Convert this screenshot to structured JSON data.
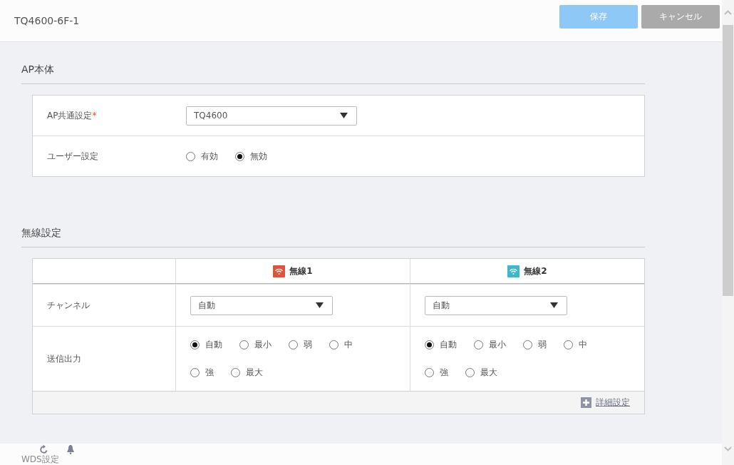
{
  "header": {
    "title": "TQ4600-6F-1",
    "buttons": [
      {
        "label": "保存",
        "kind": "primary"
      },
      {
        "label": "キャンセル",
        "kind": "secondary"
      }
    ]
  },
  "ap_section": {
    "title": "AP本体",
    "rows": [
      {
        "kind": "select",
        "label": "AP共通設定",
        "required_mark": "*",
        "value": "TQ4600"
      },
      {
        "kind": "radio",
        "label": "ユーザー設定",
        "options": [
          {
            "label": "有効",
            "selected": false
          },
          {
            "label": "無効",
            "selected": true
          }
        ]
      }
    ]
  },
  "wireless_section": {
    "title": "無線設定",
    "columns": [
      {
        "label": "無線1",
        "color": "#e0533a"
      },
      {
        "label": "無線2",
        "color": "#3bb9c9"
      }
    ],
    "rows": [
      {
        "kind": "select",
        "label": "チャンネル",
        "values": [
          "自動",
          "自動"
        ]
      },
      {
        "kind": "radio",
        "label": "送信出力",
        "options": [
          [
            {
              "label": "自動",
              "selected": true
            },
            {
              "label": "最小",
              "selected": false
            },
            {
              "label": "弱",
              "selected": false
            },
            {
              "label": "中",
              "selected": false
            },
            {
              "label": "強",
              "selected": false
            },
            {
              "label": "最大",
              "selected": false
            }
          ],
          [
            {
              "label": "自動",
              "selected": true
            },
            {
              "label": "最小",
              "selected": false
            },
            {
              "label": "弱",
              "selected": false
            },
            {
              "label": "中",
              "selected": false
            },
            {
              "label": "強",
              "selected": false
            },
            {
              "label": "最大",
              "selected": false
            }
          ]
        ]
      }
    ],
    "detail_link": "詳細設定"
  },
  "next_section": {
    "title": "WDS設定"
  }
}
